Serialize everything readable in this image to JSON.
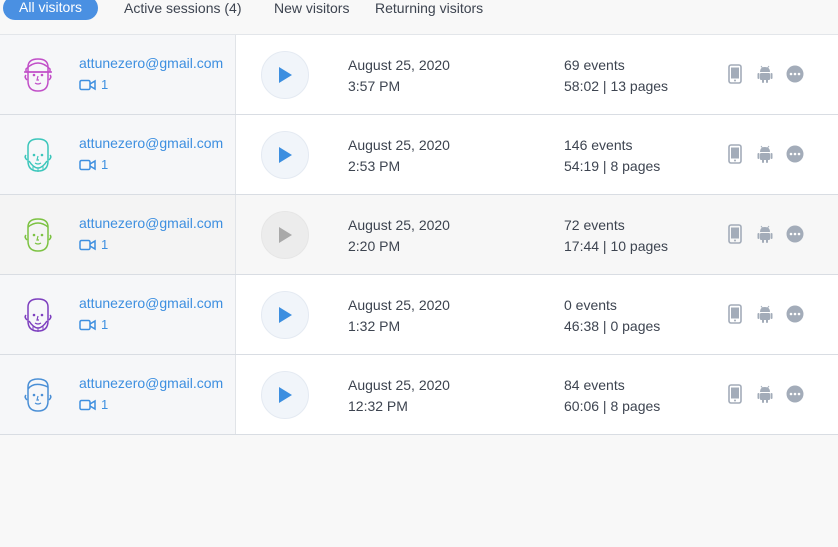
{
  "tabs": [
    {
      "label": "All visitors",
      "active": true
    },
    {
      "label": "Active sessions (4)",
      "active": false
    },
    {
      "label": "New visitors",
      "active": false
    },
    {
      "label": "Returning visitors",
      "active": false
    }
  ],
  "rows": [
    {
      "email": "attunezero@gmail.com",
      "recordings": "1",
      "date": "August 25, 2020",
      "time": "3:57 PM",
      "events": "69 events",
      "stats": "58:02 | 13 pages",
      "avatar_color": "#c14fc8"
    },
    {
      "email": "attunezero@gmail.com",
      "recordings": "1",
      "date": "August 25, 2020",
      "time": "2:53 PM",
      "events": "146 events",
      "stats": "54:19 | 8 pages",
      "avatar_color": "#3cc6bb"
    },
    {
      "email": "attunezero@gmail.com",
      "recordings": "1",
      "date": "August 25, 2020",
      "time": "2:20 PM",
      "events": "72 events",
      "stats": "17:44 | 10 pages",
      "avatar_color": "#7cc242"
    },
    {
      "email": "attunezero@gmail.com",
      "recordings": "1",
      "date": "August 25, 2020",
      "time": "1:32 PM",
      "events": "0 events",
      "stats": "46:38 | 0 pages",
      "avatar_color": "#7d3fbf"
    },
    {
      "email": "attunezero@gmail.com",
      "recordings": "1",
      "date": "August 25, 2020",
      "time": "12:32 PM",
      "events": "84 events",
      "stats": "60:06 | 8 pages",
      "avatar_color": "#4a8fd6"
    }
  ],
  "icons": {
    "device": "mobile-icon",
    "os": "android-icon",
    "more": "more-options-icon"
  },
  "colors": {
    "accent": "#4a90e2",
    "link": "#3d8fe0",
    "text": "#3d4450",
    "icon": "#a3acb9"
  }
}
